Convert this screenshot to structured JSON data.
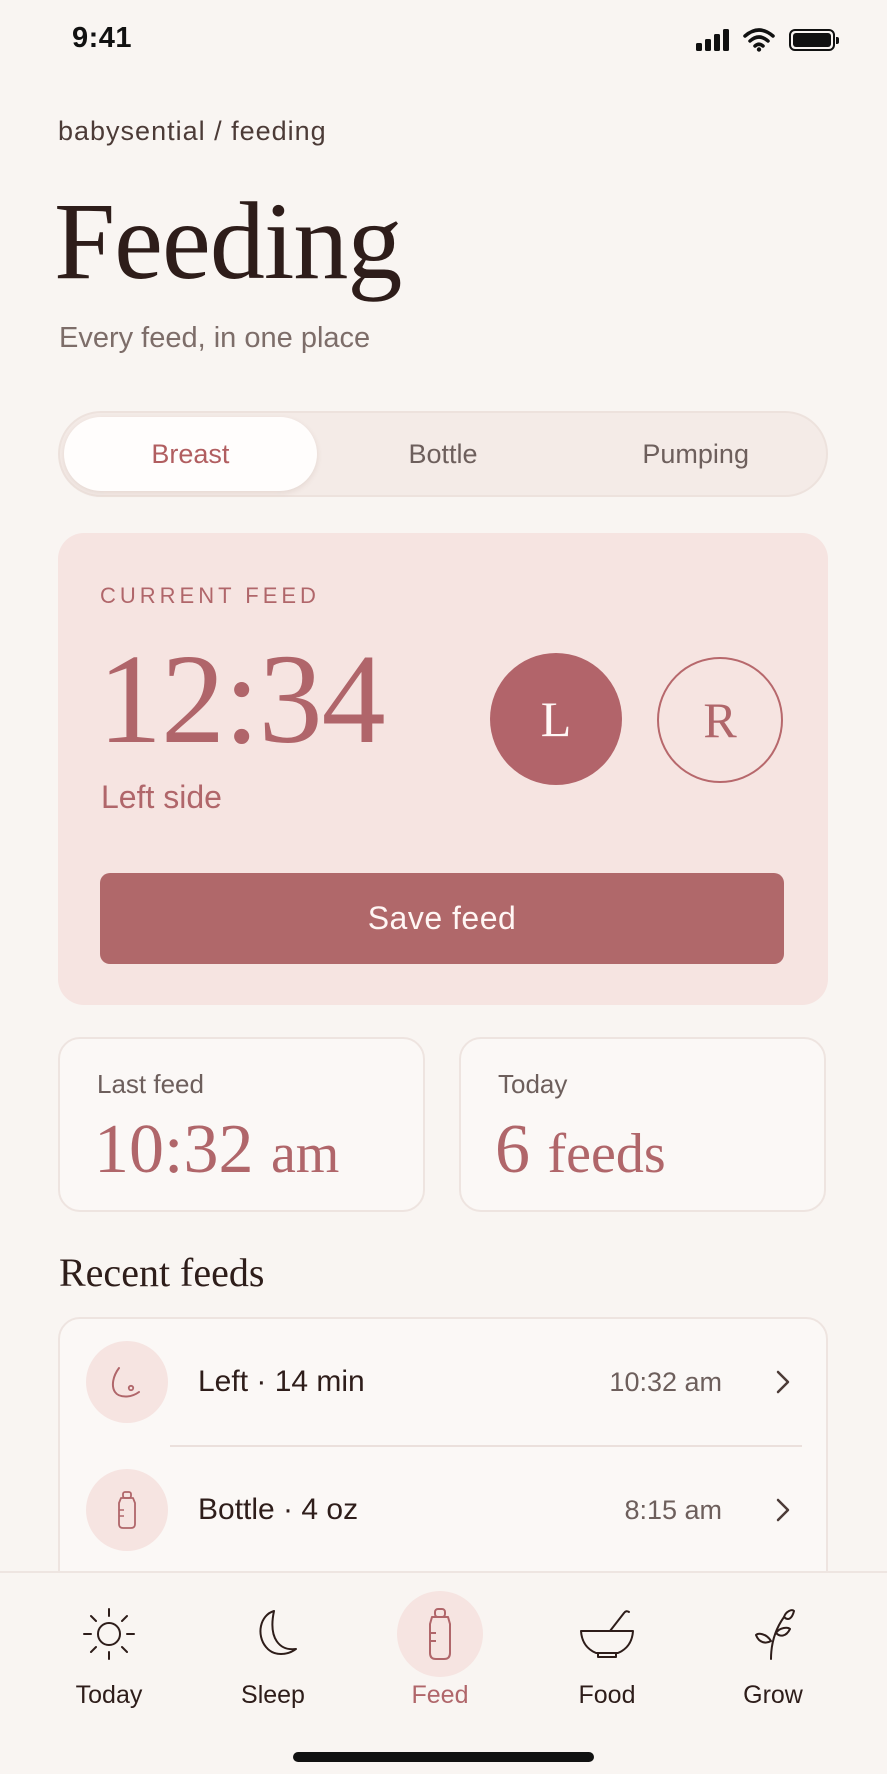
{
  "status_bar": {
    "time": "9:41"
  },
  "header": {
    "breadcrumb": "babysential / feeding",
    "title": "Feeding",
    "subtitle": "Every feed, in one place"
  },
  "segmented": {
    "tabs": [
      {
        "label": "Breast",
        "active": true
      },
      {
        "label": "Bottle",
        "active": false
      },
      {
        "label": "Pumping",
        "active": false
      }
    ]
  },
  "current_feed": {
    "label": "CURRENT FEED",
    "timer": "12:34",
    "side_text": "Left side",
    "left_button": "L",
    "right_button": "R",
    "save_label": "Save feed"
  },
  "stats": {
    "last_feed": {
      "label": "Last feed",
      "value": "10:32",
      "unit": "am"
    },
    "today": {
      "label": "Today",
      "value": "6",
      "unit": "feeds"
    }
  },
  "recent": {
    "title": "Recent feeds",
    "items": [
      {
        "icon": "breast-icon",
        "title": "Left · 14 min",
        "time": "10:32 am"
      },
      {
        "icon": "bottle-icon",
        "title": "Bottle · 4 oz",
        "time": "8:15 am"
      }
    ]
  },
  "tab_bar": {
    "items": [
      {
        "label": "Today",
        "icon": "sun-icon"
      },
      {
        "label": "Sleep",
        "icon": "moon-icon"
      },
      {
        "label": "Feed",
        "icon": "bottle-icon",
        "active": true
      },
      {
        "label": "Food",
        "icon": "bowl-icon"
      },
      {
        "label": "Grow",
        "icon": "sprout-icon"
      }
    ]
  },
  "colors": {
    "accent": "#b0666a",
    "card_bg": "#f6e4e1",
    "background": "#f9f5f2"
  }
}
